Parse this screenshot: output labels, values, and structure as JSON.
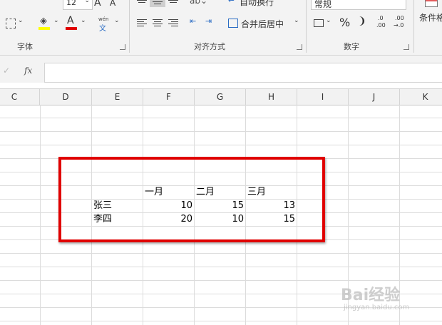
{
  "ribbon": {
    "font_size_value": "12",
    "font_grow_glyph": "A",
    "font_shrink_glyph": "A",
    "font_color_glyph": "A",
    "phonetic_top": "wén",
    "phonetic_bottom": "文",
    "wrap_text_label": "自动换行",
    "merge_center_label": "合并后居中",
    "number_format_value": "常规",
    "percent_glyph": "%",
    "comma_glyph": "❩",
    "increase_decimal_top": ".0",
    "increase_decimal_bottom": ".00",
    "decrease_decimal_top": ".00",
    "decrease_decimal_bottom": "→.0",
    "conditional_format_label": "条件格",
    "group_font": "字体",
    "group_alignment": "对齐方式",
    "group_number": "数字",
    "colors": {
      "fill_yellow": "#ffff00",
      "font_red": "#e00000"
    }
  },
  "formula_bar": {
    "fx_label": "fx",
    "value": ""
  },
  "columns": [
    "C",
    "D",
    "E",
    "F",
    "G",
    "H",
    "I",
    "J",
    "K"
  ],
  "table": {
    "headers": [
      "一月",
      "二月",
      "三月"
    ],
    "rows": [
      {
        "name": "张三",
        "values": [
          "10",
          "15",
          "13"
        ]
      },
      {
        "name": "李四",
        "values": [
          "20",
          "10",
          "15"
        ]
      }
    ]
  },
  "highlight": {
    "color": "#e00000"
  },
  "watermark": {
    "brand": "Bai经验",
    "url": "jingyan.baidu.com"
  }
}
